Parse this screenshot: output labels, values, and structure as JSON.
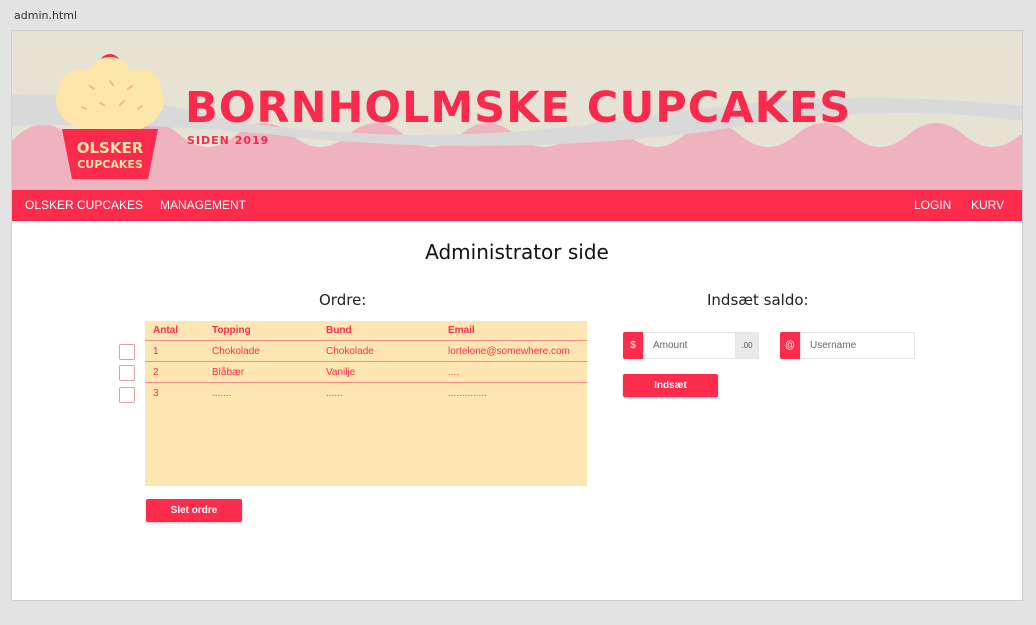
{
  "window": {
    "file_label": "admin.html"
  },
  "header": {
    "brand_title": "BORNHOLMSKE CUPCAKES",
    "brand_subtitle": "SIDEN 2019",
    "logo_line1": "OLSKER",
    "logo_line2": "CUPCAKES"
  },
  "navbar": {
    "left_items": [
      "OLSKER CUPCAKES",
      "MANAGEMENT"
    ],
    "right_items": [
      "LOGIN",
      "KURV"
    ]
  },
  "page": {
    "title": "Administrator side"
  },
  "orders": {
    "heading": "Ordre:",
    "columns": [
      "Antal",
      "Topping",
      "Bund",
      "Email"
    ],
    "rows": [
      [
        "1",
        "Chokolade",
        "Chokolade",
        "lortelone@somewhere.com"
      ],
      [
        "2",
        "Blåbær",
        "Vanilje",
        "...."
      ],
      [
        "3",
        ".......",
        "......",
        ".............."
      ]
    ],
    "delete_button": "Slet ordre"
  },
  "balance": {
    "heading": "Indsæt saldo:",
    "amount_addon": "$",
    "amount_placeholder": "Amount",
    "amount_suffix": ".00",
    "username_addon": "@",
    "username_placeholder": "Username",
    "submit_button": "Indsæt"
  },
  "colors": {
    "accent": "#fe2c4c",
    "table_bg": "#fee6b3",
    "header_bg": "#e6e3d5",
    "wave_grey": "#d9d9d9",
    "wave_pink": "#efb3bf"
  }
}
